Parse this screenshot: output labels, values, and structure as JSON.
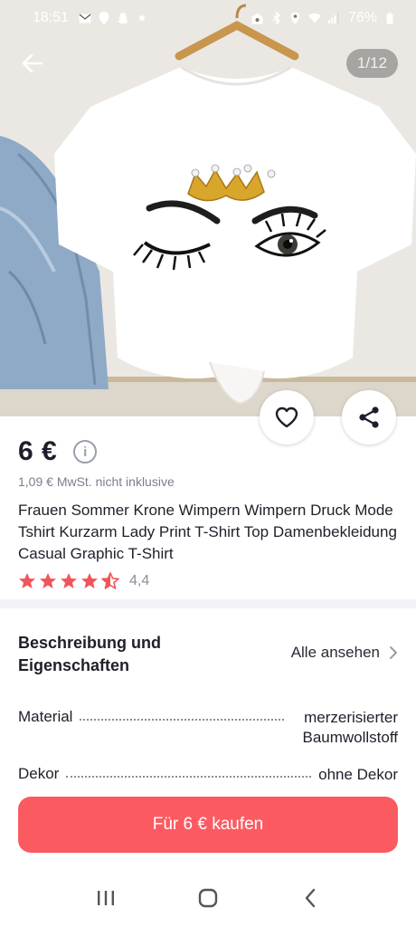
{
  "status_bar": {
    "time": "18:51",
    "battery": "76%",
    "icons_left": [
      "mail-icon",
      "location-pin-icon",
      "snapchat-icon",
      "dot-icon"
    ],
    "icons_right": [
      "wifi-home-icon",
      "bluetooth-icon",
      "location-icon",
      "wifi-icon",
      "signal-icon",
      "battery-icon"
    ]
  },
  "gallery": {
    "counter": "1/12"
  },
  "product": {
    "price": "6 €",
    "vat_note": "1,09 € MwSt. nicht inklusive",
    "title": "Frauen Sommer Krone Wimpern Wimpern Druck Mode Tshirt Kurzarm Lady Print T-Shirt Top Damenbekleidung Casual Graphic T-Shirt",
    "rating": 4.4,
    "rating_text": "4,4"
  },
  "description": {
    "title": "Beschreibung und Eigenschaften",
    "see_all": "Alle ansehen",
    "specs": [
      {
        "key": "Material",
        "value": "merzerisierter Baumwollstoff"
      },
      {
        "key": "Dekor",
        "value": "ohne Dekor"
      }
    ]
  },
  "actions": {
    "buy_label": "Für 6 € kaufen"
  },
  "colors": {
    "accent": "#fc5a61",
    "star": "#f0555b",
    "text_secondary": "#7b7f8e"
  }
}
